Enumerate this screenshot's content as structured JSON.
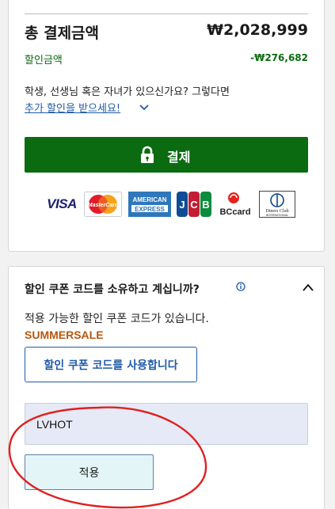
{
  "summary": {
    "total_label": "총 결제금액",
    "total_value": "₩2,028,999",
    "discount_label": "할인금액",
    "discount_value": "-₩276,682",
    "promo_text": "학생, 선생님 혹은 자녀가 있으신가요? 그렇다면",
    "promo_link": "추가 할인을 받으세요!",
    "pay_button": "결제",
    "payment_logos": [
      "VISA",
      "MasterCard",
      "AMERICAN EXPRESS",
      "JCB",
      "BCcard",
      "Diners Club INTERNATIONAL"
    ],
    "brand_color": "#0b6b10"
  },
  "coupon": {
    "question": "할인 쿠폰 코드를 소유하고 계십니까?",
    "available_text": "적용 가능한 할인 쿠폰 코드가 있습니다.",
    "available_code": "SUMMERSALE",
    "use_code_button": "할인 쿠폰 코드를 사용합니다",
    "input_value": "LVHOT",
    "apply_button": "적용",
    "link_color": "#1f5aa6",
    "code_color": "#b8560d",
    "annotation_color": "#e02020"
  }
}
